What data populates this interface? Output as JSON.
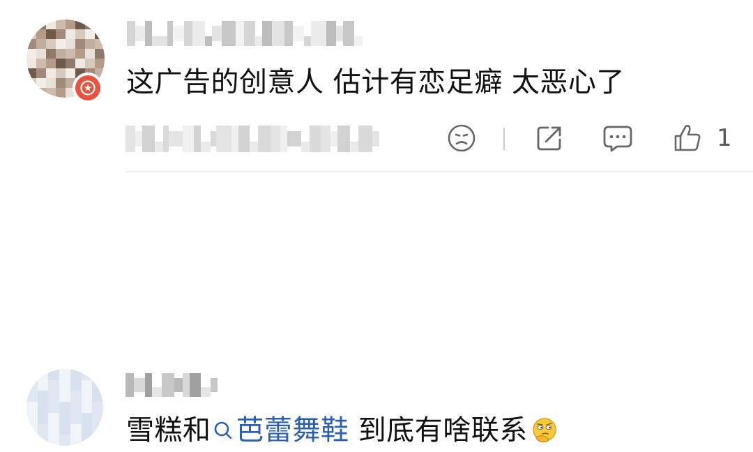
{
  "comments": [
    {
      "text": "这广告的创意人 估计有恋足癖 太恶心了",
      "like_count": "1",
      "actions": [
        "dislike-icon",
        "share-icon",
        "reply-icon",
        "like-icon"
      ]
    },
    {
      "text_before": "雪糕和",
      "link_text": "芭蕾舞鞋",
      "text_after": " 到底有啥联系",
      "emoji": "thinking-face-emoji"
    }
  ],
  "colors": {
    "link": "#2a5fb0",
    "badge": "#e8533f",
    "icon": "#666666",
    "divider": "#eeeeee"
  }
}
